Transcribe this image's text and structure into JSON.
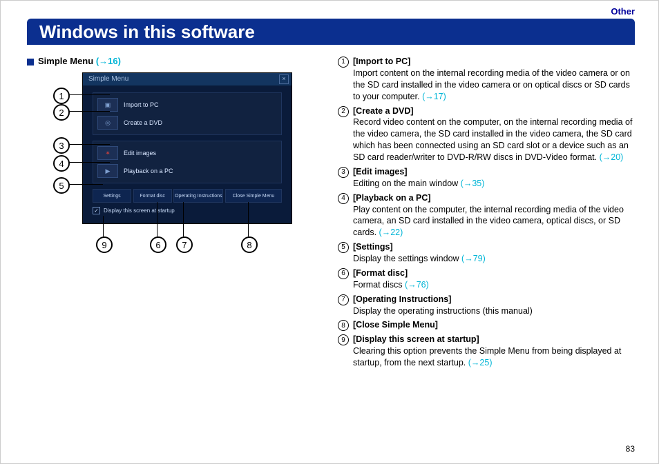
{
  "header": {
    "category": "Other",
    "title": "Windows in this software"
  },
  "pagenum": "83",
  "left": {
    "section_label": "Simple Menu",
    "section_link": "(→16)",
    "shot": {
      "titlebar": "Simple Menu",
      "rows": {
        "r1": "Import to PC",
        "r2": "Create a DVD",
        "r3": "Edit images",
        "r4": "Playback on a PC"
      },
      "btm": {
        "b1": "Settings",
        "b2": "Format disc",
        "b3": "Operating Instructions",
        "b4": "Close Simple Menu"
      },
      "startup": "Display this screen at startup"
    },
    "nums": {
      "n1": "1",
      "n2": "2",
      "n3": "3",
      "n4": "4",
      "n5": "5",
      "n6": "6",
      "n7": "7",
      "n8": "8",
      "n9": "9"
    }
  },
  "right": {
    "i1": {
      "n": "1",
      "t": "[Import to PC]",
      "d": "Import content on the internal recording media of the video camera or on the SD card installed in the video camera or on optical discs or SD cards to your computer.",
      "l": "(→17)"
    },
    "i2": {
      "n": "2",
      "t": "[Create a DVD]",
      "d": "Record video content on the computer, on the internal recording media of the video camera, the SD card installed in the video camera, the SD card which has been connected using an SD card slot or a device such as an SD card reader/writer to DVD-R/RW discs in DVD-Video format.",
      "l": "(→20)"
    },
    "i3": {
      "n": "3",
      "t": "[Edit images]",
      "d": "Editing on the main window",
      "l": "(→35)"
    },
    "i4": {
      "n": "4",
      "t": "[Playback on a PC]",
      "d": "Play content on the computer, the internal recording media of the video camera, an SD card installed in the video camera, optical discs, or SD cards.",
      "l": "(→22)"
    },
    "i5": {
      "n": "5",
      "t": "[Settings]",
      "d": "Display the settings window",
      "l": "(→79)"
    },
    "i6": {
      "n": "6",
      "t": "[Format disc]",
      "d": "Format discs",
      "l": "(→76)"
    },
    "i7": {
      "n": "7",
      "t": "[Operating Instructions]",
      "d": "Display the operating instructions (this manual)",
      "l": ""
    },
    "i8": {
      "n": "8",
      "t": "[Close Simple Menu]",
      "d": "",
      "l": ""
    },
    "i9": {
      "n": "9",
      "t": "[Display this screen at startup]",
      "d": "Clearing this option prevents the Simple Menu from being displayed at startup, from the next startup.",
      "l": "(→25)"
    }
  }
}
